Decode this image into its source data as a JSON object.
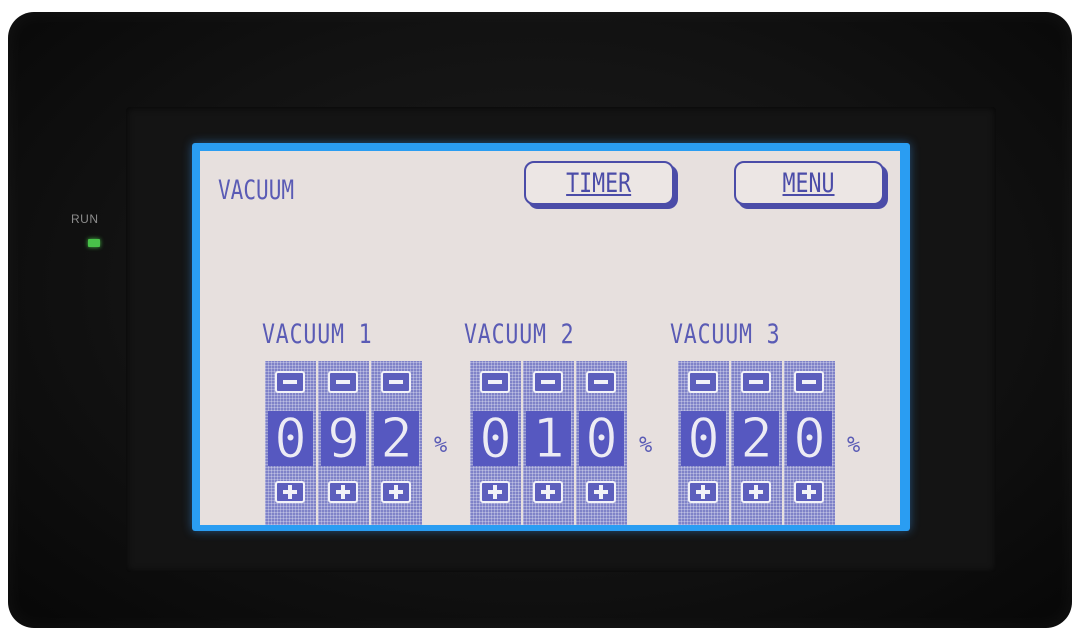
{
  "device": {
    "run_label": "RUN",
    "led_color": "#49c24a"
  },
  "screen": {
    "title": "VACUUM",
    "buttons": {
      "timer": "TIMER",
      "menu": "MENU"
    },
    "colors": {
      "text": "#5a5bb5",
      "panel": "#e7e0de",
      "digit_bg": "#5658c0",
      "border": "#2a9df2"
    },
    "groups": [
      {
        "label": "VACUUM 1",
        "digits": [
          "0",
          "9",
          "2"
        ],
        "unit": "%"
      },
      {
        "label": "VACUUM 2",
        "digits": [
          "0",
          "1",
          "0"
        ],
        "unit": "%"
      },
      {
        "label": "VACUUM 3",
        "digits": [
          "0",
          "2",
          "0"
        ],
        "unit": "%"
      }
    ],
    "step_icons": {
      "decrement": "minus-icon",
      "increment": "plus-icon"
    }
  }
}
